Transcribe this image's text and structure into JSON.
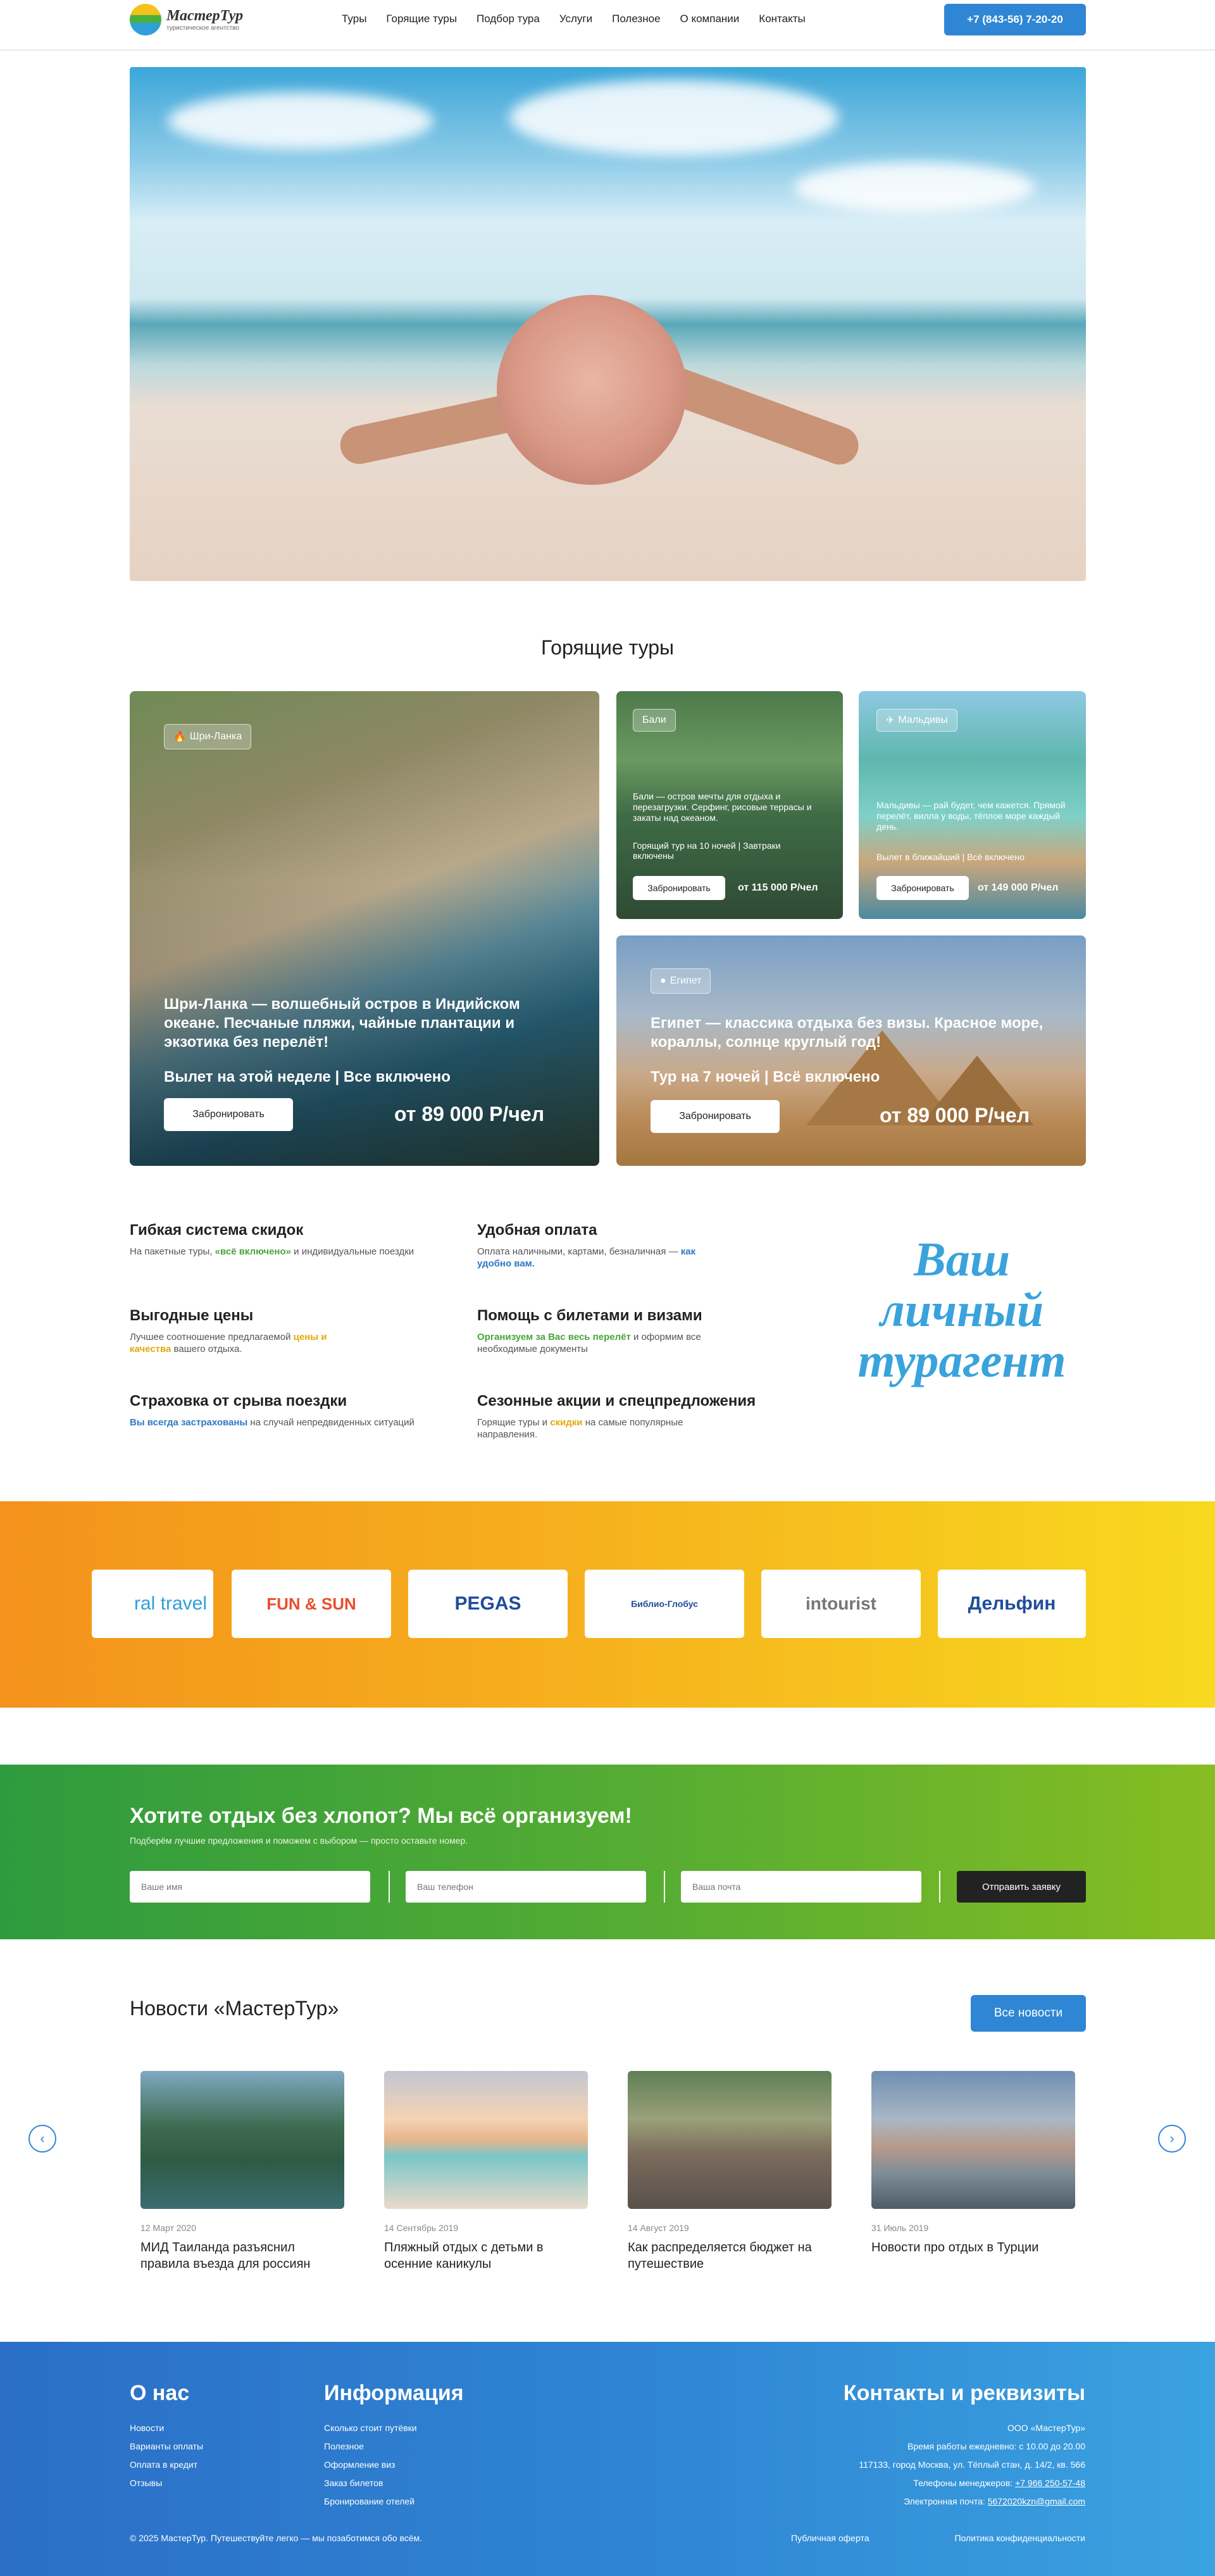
{
  "header": {
    "logo_name": "МастерТур",
    "logo_sub": "туристическое агентство",
    "nav": [
      "Туры",
      "Горящие туры",
      "Подбор тура",
      "Услуги",
      "Полезное",
      "О компании",
      "Контакты"
    ],
    "phone": "+7 (843-56) 7-20-20"
  },
  "hot": {
    "title": "Горящие туры",
    "book_label": "Забронировать",
    "srilanka": {
      "badge": "Шри-Ланка",
      "desc": "Шри-Ланка — волшебный остров в Индийском океане. Песчаные пляжи, чайные плантации и экзотика без перелёт!",
      "meta": "Вылет на этой неделе | Все включено",
      "price": "от 89 000 Р/чел"
    },
    "bali": {
      "badge": "Бали",
      "desc": "Бали — остров мечты для отдыха и перезагрузки. Серфинг, рисовые террасы и закаты над океаном.",
      "meta": "Горящий тур на 10 ночей | Завтраки включены",
      "price": "от 115 000 Р/чел"
    },
    "maldives": {
      "badge": "Мальдивы",
      "desc": "Мальдивы — рай будет, чем кажется. Прямой перелёт, вилла у воды, тёплое море каждый день.",
      "meta": "Вылет в ближайший | Всё включено",
      "price": "от 149 000 Р/чел"
    },
    "egypt": {
      "badge": "Египет",
      "desc": "Египет — классика отдыха без визы. Красное море, кораллы, солнце круглый год!",
      "meta": "Тур на 7 ночей | Всё включено",
      "price": "от 89 000 Р/чел"
    }
  },
  "features": {
    "f1": {
      "title": "Гибкая система скидок",
      "t1": "На пакетные туры, ",
      "hl": "«всё включено»",
      "t2": " и индивидуальные поездки"
    },
    "f2": {
      "title": "Удобная оплата",
      "t1": "Оплата наличными, картами, безналичная — ",
      "hl": "как удобно вам."
    },
    "f3": {
      "title": "Выгодные цены",
      "t1": "Лучшее соотношение предлагаемой ",
      "hl": "цены и качества",
      "t2": " вашего отдыха."
    },
    "f4": {
      "title": "Помощь с билетами и визами",
      "hl": "Организуем за Вас весь перелёт",
      "t2": " и оформим все необходимые документы"
    },
    "f5": {
      "title": "Страховка от срыва поездки",
      "hl": "Вы всегда застрахованы",
      "t2": " на случай непредвиденных ситуаций"
    },
    "f6": {
      "title": "Сезонные акции и спецпредложения",
      "t1": "Горящие туры и ",
      "hl": "скидки",
      "t2": " на самые популярные направления."
    },
    "agent_line1": "Ваш",
    "agent_line2": "личный",
    "agent_line3": "турагент"
  },
  "partners": [
    "ral travel",
    "FUN & SUN",
    "PEGAS",
    "Библио-Глобус",
    "intourist",
    "Дельфин"
  ],
  "form": {
    "title": "Хотите отдых без хлопот? Мы всё организуем!",
    "subtitle": "Подберём лучшие предложения и поможем с выбором — просто оставьте номер.",
    "name_ph": "Ваше имя",
    "phone_ph": "Ваш телефон",
    "email_ph": "Ваша почта",
    "send": "Отправить заявку"
  },
  "news": {
    "title": "Новости «МастерТур»",
    "all": "Все новости",
    "items": [
      {
        "date": "12 Март 2020",
        "title": "МИД Таиланда разъяснил правила въезда для россиян"
      },
      {
        "date": "14 Сентябрь 2019",
        "title": "Пляжный отдых с детьми в осенние каникулы"
      },
      {
        "date": "14 Август 2019",
        "title": "Как распределяется бюджет на путешествие"
      },
      {
        "date": "31 Июль 2019",
        "title": "Новости про отдых в Турции"
      }
    ]
  },
  "footer": {
    "about_title": "О нас",
    "about_links": [
      "Новости",
      "Варианты оплаты",
      "Оплата в кредит",
      "Отзывы"
    ],
    "info_title": "Информация",
    "info_links": [
      "Сколько стоит путёвки",
      "Полезное",
      "Оформление виз",
      "Заказ билетов",
      "Бронирование отелей"
    ],
    "contacts_title": "Контакты и реквизиты",
    "company": "ООО «МастерТур»",
    "hours": "Время работы ежедневно: с 10.00 до 20.00",
    "address": "117133, город Москва, ул. Тёплый стан, д. 14/2, кв. 566",
    "phones_label": "Телефоны менеджеров: ",
    "phones": "+7 966 250-57-48",
    "email_label": "Электронная почта: ",
    "email": "5672020kzn@gmail.com",
    "copyright": "© 2025 МастерТур. Путешествуйте легко — мы позаботимся обо всём.",
    "offer": "Публичная оферта",
    "privacy": "Политика конфиденциальности"
  },
  "colors": {
    "accent": "#2f86d4",
    "green": "#4aa53c",
    "yellow": "#f6b21d"
  }
}
